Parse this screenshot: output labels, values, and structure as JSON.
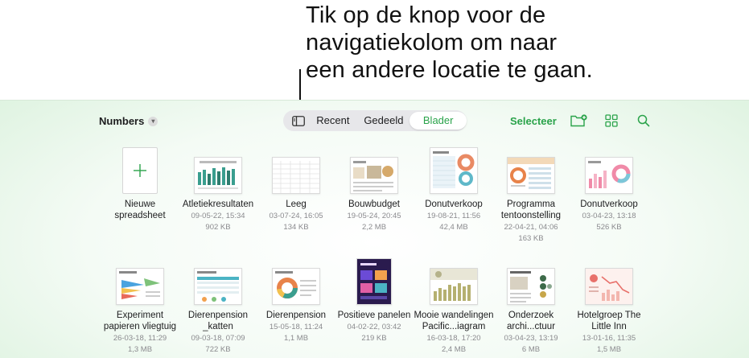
{
  "callout": {
    "text": "Tik op de knop voor de\nnavigatiekolom om naar\neen andere locatie te gaan."
  },
  "header": {
    "app_name": "Numbers",
    "tabs": [
      "Recent",
      "Gedeeld",
      "Blader"
    ],
    "active_tab": "Blader",
    "select_label": "Selecteer"
  },
  "colors": {
    "accent": "#2aa34a",
    "background_tint": "#dcf2de"
  },
  "icons": {
    "sidebar": "sidebar-icon",
    "new_folder": "folder-plus-icon",
    "grid": "grid-icon",
    "search": "search-icon",
    "new": "plus-icon",
    "chevron": "chevron-down-icon"
  },
  "new_spreadsheet": {
    "label": "Nieuwe\nspreadsheet"
  },
  "files": [
    {
      "name": "Atletiekresultaten",
      "date": "09-05-22, 15:34",
      "size": "902 KB"
    },
    {
      "name": "Leeg",
      "date": "03-07-24, 16:05",
      "size": "134 KB"
    },
    {
      "name": "Bouwbudget",
      "date": "19-05-24, 20:45",
      "size": "2,2 MB"
    },
    {
      "name": "Donutverkoop",
      "date": "19-08-21, 11:56",
      "size": "42,4 MB"
    },
    {
      "name": "Programma\ntentoonstelling",
      "date": "22-04-21, 04:06",
      "size": "163 KB"
    },
    {
      "name": "Donutverkoop",
      "date": "03-04-23, 13:18",
      "size": "526 KB"
    },
    {
      "name": "Experiment\npapieren vliegtuig",
      "date": "26-03-18, 11:29",
      "size": "1,3 MB"
    },
    {
      "name": "Dierenpension\n_katten",
      "date": "09-03-18, 07:09",
      "size": "722 KB"
    },
    {
      "name": "Dierenpension",
      "date": "15-05-18, 11:24",
      "size": "1,1 MB"
    },
    {
      "name": "Positieve panelen",
      "date": "04-02-22, 03:42",
      "size": "219 KB"
    },
    {
      "name": "Mooie wandelingen\nPacific...iagram",
      "date": "16-03-18, 17:20",
      "size": "2,4 MB"
    },
    {
      "name": "Onderzoek\narchi...ctuur",
      "date": "03-04-23, 13:19",
      "size": "6 MB"
    },
    {
      "name": "Hotelgroep The\nLittle Inn",
      "date": "13-01-16, 11:35",
      "size": "1,5 MB"
    }
  ]
}
